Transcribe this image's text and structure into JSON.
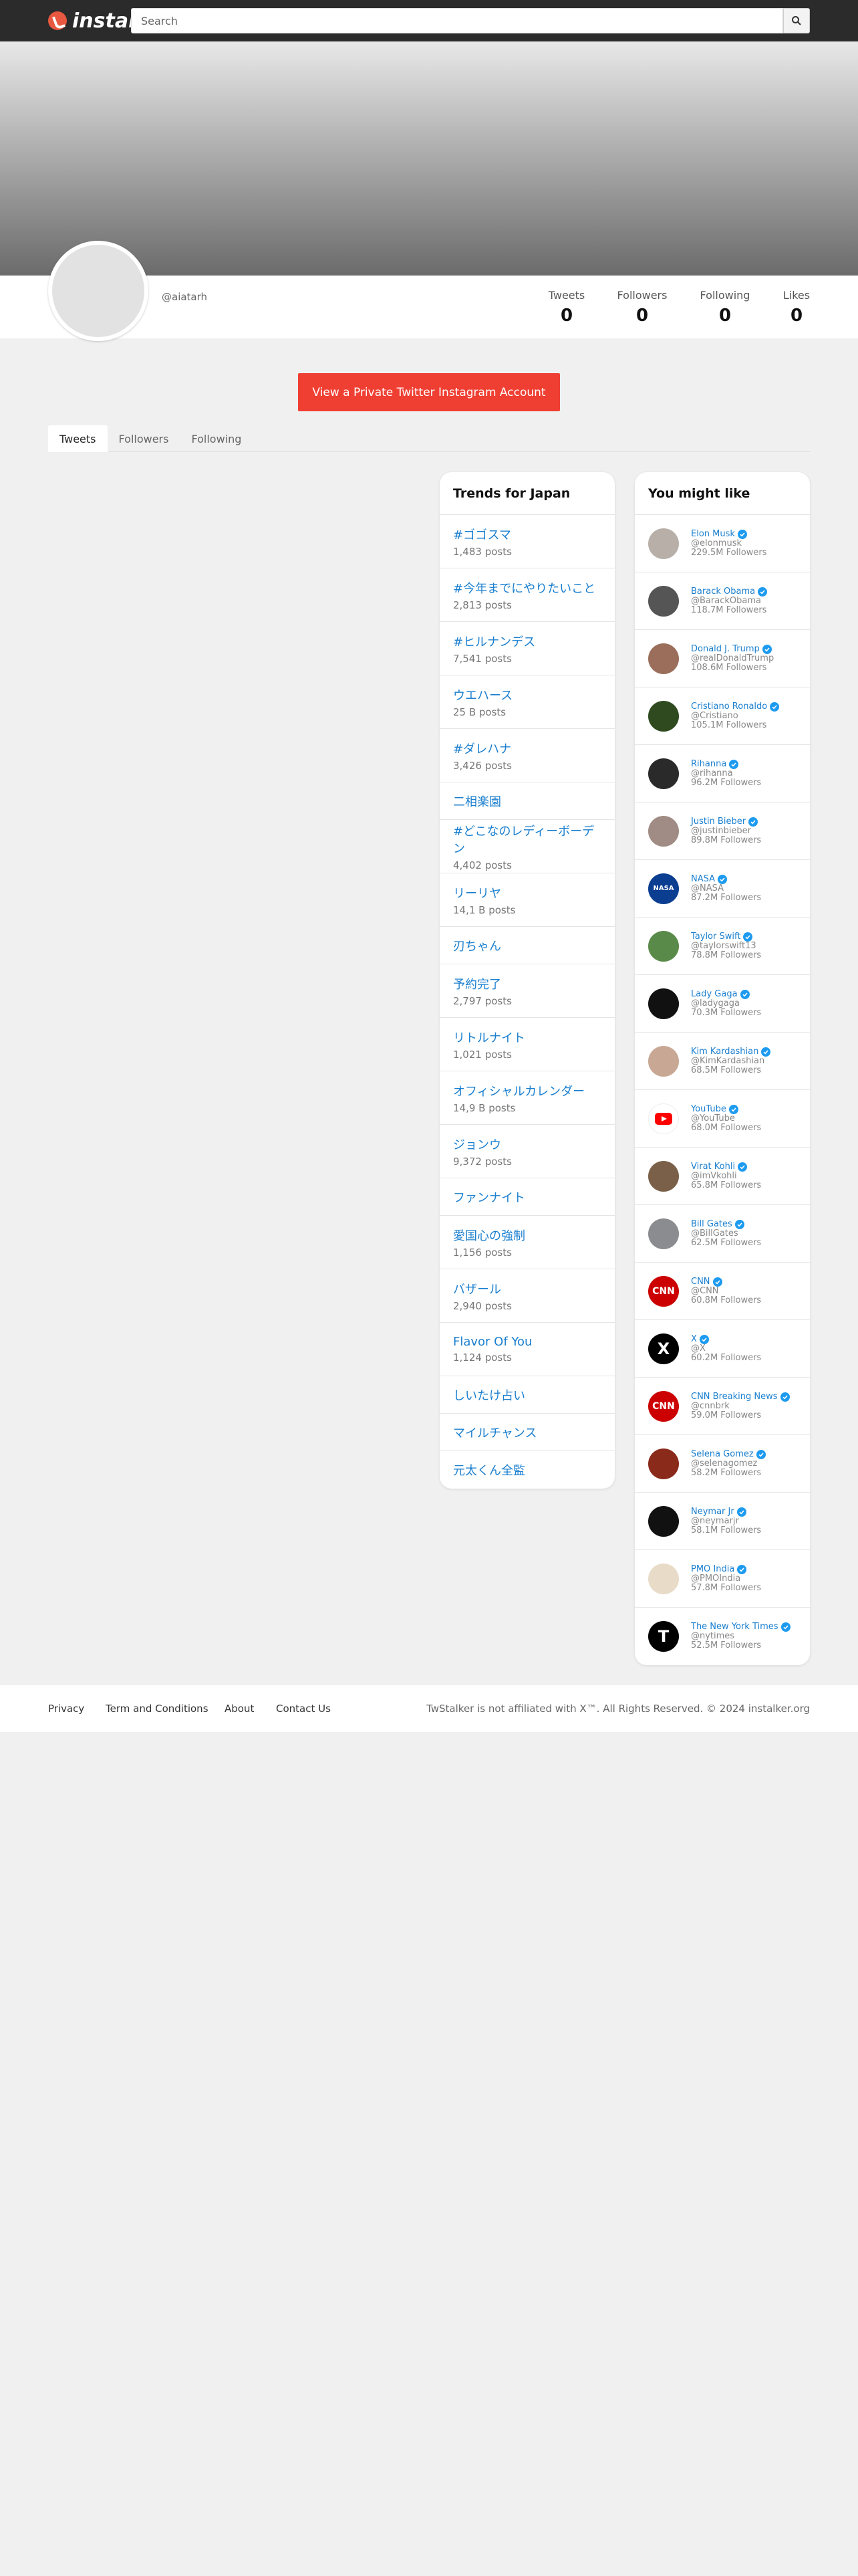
{
  "header": {
    "logo_text": "instalk",
    "search_placeholder": "Search"
  },
  "profile": {
    "handle": "@aiatarh",
    "stats": [
      {
        "label": "Tweets",
        "value": "0"
      },
      {
        "label": "Followers",
        "value": "0"
      },
      {
        "label": "Following",
        "value": "0"
      },
      {
        "label": "Likes",
        "value": "0"
      }
    ]
  },
  "cta_label": "View a Private Twitter Instagram Account",
  "tabs": [
    "Tweets",
    "Followers",
    "Following"
  ],
  "trends": {
    "title": "Trends for Japan",
    "items": [
      {
        "name": "#ゴゴスマ",
        "posts": "1,483 posts"
      },
      {
        "name": "#今年までにやりたいこと",
        "posts": "2,813 posts"
      },
      {
        "name": "#ヒルナンデス",
        "posts": "7,541 posts"
      },
      {
        "name": "ウエハース",
        "posts": "25 B posts"
      },
      {
        "name": "#ダレハナ",
        "posts": "3,426 posts"
      },
      {
        "name": "二相楽園",
        "posts": ""
      },
      {
        "name": "#どこなのレディーボーデン",
        "posts": "4,402 posts"
      },
      {
        "name": "リーリヤ",
        "posts": "14,1 B posts"
      },
      {
        "name": "刃ちゃん",
        "posts": ""
      },
      {
        "name": "予約完了",
        "posts": "2,797 posts"
      },
      {
        "name": "リトルナイト",
        "posts": "1,021 posts"
      },
      {
        "name": "オフィシャルカレンダー",
        "posts": "14,9 B posts"
      },
      {
        "name": "ジョンウ",
        "posts": "9,372 posts"
      },
      {
        "name": "ファンナイト",
        "posts": ""
      },
      {
        "name": "愛国心の強制",
        "posts": "1,156 posts"
      },
      {
        "name": "バザール",
        "posts": "2,940 posts"
      },
      {
        "name": "Flavor Of You",
        "posts": "1,124 posts"
      },
      {
        "name": "しいたけ占い",
        "posts": ""
      },
      {
        "name": "マイルチャンス",
        "posts": ""
      },
      {
        "name": "元太くん全監",
        "posts": ""
      }
    ]
  },
  "suggestions": {
    "title": "You might like",
    "users": [
      {
        "name": "Elon Musk",
        "handle": "@elonmusk",
        "followers": "229.5M Followers",
        "avatar_color": "#b8b0a8",
        "avatar_text": ""
      },
      {
        "name": "Barack Obama",
        "handle": "@BarackObama",
        "followers": "118.7M Followers",
        "avatar_color": "#555555",
        "avatar_text": ""
      },
      {
        "name": "Donald J. Trump",
        "handle": "@realDonaldTrump",
        "followers": "108.6M Followers",
        "avatar_color": "#9a6e5a",
        "avatar_text": ""
      },
      {
        "name": "Cristiano Ronaldo",
        "handle": "@Cristiano",
        "followers": "105.1M Followers",
        "avatar_color": "#2e4a1e",
        "avatar_text": ""
      },
      {
        "name": "Rihanna",
        "handle": "@rihanna",
        "followers": "96.2M Followers",
        "avatar_color": "#2a2a2a",
        "avatar_text": ""
      },
      {
        "name": "Justin Bieber",
        "handle": "@justinbieber",
        "followers": "89.8M Followers",
        "avatar_color": "#a08c84",
        "avatar_text": ""
      },
      {
        "name": "NASA",
        "handle": "@NASA",
        "followers": "87.2M Followers",
        "avatar_color": "#0b3d91",
        "avatar_text": "NASA"
      },
      {
        "name": "Taylor Swift",
        "handle": "@taylorswift13",
        "followers": "78.8M Followers",
        "avatar_color": "#5a8a4a",
        "avatar_text": ""
      },
      {
        "name": "Lady Gaga",
        "handle": "@ladygaga",
        "followers": "70.3M Followers",
        "avatar_color": "#111111",
        "avatar_text": ""
      },
      {
        "name": "Kim Kardashian",
        "handle": "@KimKardashian",
        "followers": "68.5M Followers",
        "avatar_color": "#c8a894",
        "avatar_text": ""
      },
      {
        "name": "YouTube",
        "handle": "@YouTube",
        "followers": "68.0M Followers",
        "avatar_color": "#ffffff",
        "avatar_text": ""
      },
      {
        "name": "Virat Kohli",
        "handle": "@imVkohli",
        "followers": "65.8M Followers",
        "avatar_color": "#7a6048",
        "avatar_text": ""
      },
      {
        "name": "Bill Gates",
        "handle": "@BillGates",
        "followers": "62.5M Followers",
        "avatar_color": "#8a8c90",
        "avatar_text": ""
      },
      {
        "name": "CNN",
        "handle": "@CNN",
        "followers": "60.8M Followers",
        "avatar_color": "#cc0000",
        "avatar_text": "CNN"
      },
      {
        "name": "X",
        "handle": "@X",
        "followers": "60.2M Followers",
        "avatar_color": "#000000",
        "avatar_text": "X"
      },
      {
        "name": "CNN Breaking News",
        "handle": "@cnnbrk",
        "followers": "59.0M Followers",
        "avatar_color": "#cc0000",
        "avatar_text": "CNN"
      },
      {
        "name": "Selena Gomez",
        "handle": "@selenagomez",
        "followers": "58.2M Followers",
        "avatar_color": "#8a2a1a",
        "avatar_text": ""
      },
      {
        "name": "Neymar Jr",
        "handle": "@neymarjr",
        "followers": "58.1M Followers",
        "avatar_color": "#111111",
        "avatar_text": ""
      },
      {
        "name": "PMO India",
        "handle": "@PMOIndia",
        "followers": "57.8M Followers",
        "avatar_color": "#e8dcc8",
        "avatar_text": ""
      },
      {
        "name": "The New York Times",
        "handle": "@nytimes",
        "followers": "52.5M Followers",
        "avatar_color": "#000000",
        "avatar_text": "T"
      }
    ]
  },
  "footer": {
    "links": [
      "Privacy",
      "Term and Conditions",
      "About",
      "Contact Us"
    ],
    "copyright": "TwStalker is not affiliated with X™. All Rights Reserved. © 2024 instalker.org"
  },
  "colors": {
    "accent": "#ef3f32",
    "link": "#1a7fcf",
    "verified": "#1d9bf0"
  },
  "icons": [
    "logo-icon",
    "search-icon",
    "verified-icon"
  ]
}
